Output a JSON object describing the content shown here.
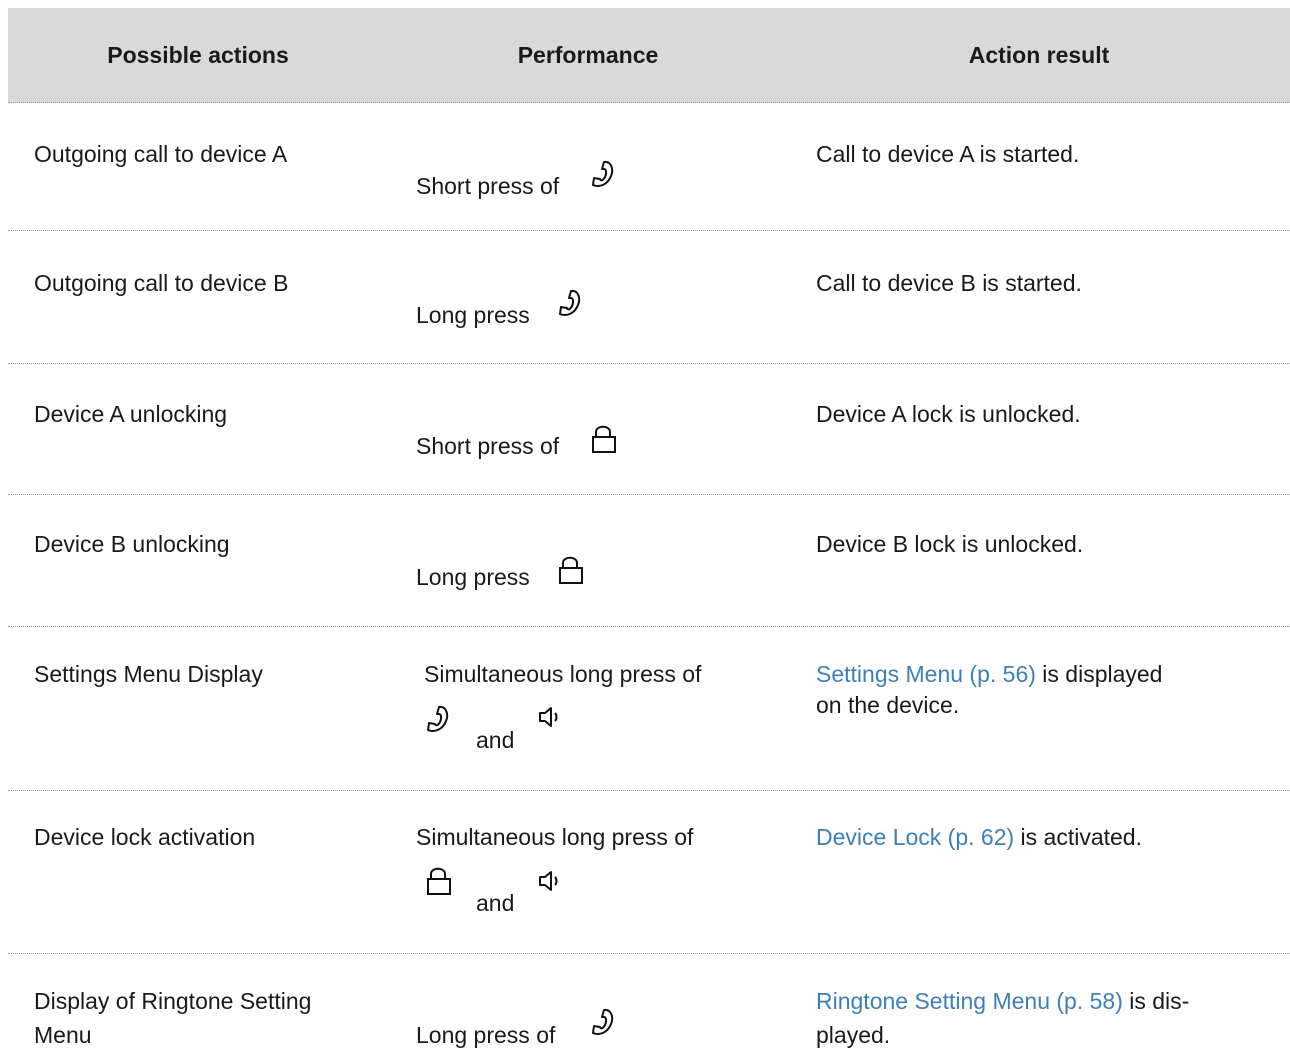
{
  "header": {
    "col_actions": "Possible actions",
    "col_performance": "Performance",
    "col_result": "Action result"
  },
  "rows": [
    {
      "action": "Outgoing call to device A",
      "performance": "Short press of",
      "result": "Call to device A is started."
    },
    {
      "action": "Outgoing call to device B",
      "performance": "Long press",
      "result": "Call to device B is started."
    },
    {
      "action": "Device A unlocking",
      "performance": "Short press of",
      "result": "Device A lock is unlocked."
    },
    {
      "action": "Device B unlocking",
      "performance": "Long press",
      "result": "Device B lock is unlocked."
    },
    {
      "action": "Settings Menu Display",
      "performance": "Simultaneous long press of",
      "and": "and",
      "result_link": "Settings Menu (p. 56)",
      "result_rest": " is displayed",
      "result_line2": "on the device."
    },
    {
      "action": "Device lock activation",
      "performance": "Simultaneous long press of",
      "and": "and",
      "result_link": "Device Lock (p. 62)",
      "result_rest": " is activated."
    },
    {
      "action_line1": "Display of Ringtone Setting",
      "action_line2": "Menu",
      "performance": "Long press of",
      "result_link": "Ringtone Setting Menu (p. 58)",
      "result_rest": " is dis-",
      "result_line2": "played."
    }
  ],
  "icons": {
    "handset": "phone-handset-icon",
    "lock": "lock-open-icon",
    "speaker": "speaker-icon"
  }
}
